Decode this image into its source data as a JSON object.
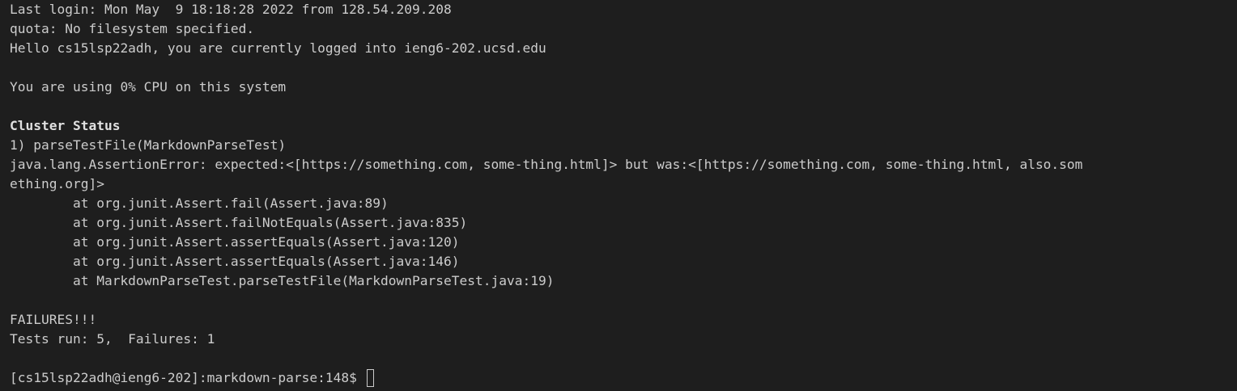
{
  "terminal": {
    "lines": [
      "Last login: Mon May  9 18:18:28 2022 from 128.54.209.208",
      "quota: No filesystem specified.",
      "Hello cs15lsp22adh, you are currently logged into ieng6-202.ucsd.edu",
      "",
      "You are using 0% CPU on this system",
      "",
      "Cluster Status",
      "1) parseTestFile(MarkdownParseTest)",
      "java.lang.AssertionError: expected:<[https://something.com, some-thing.html]> but was:<[https://something.com, some-thing.html, also.som",
      "ething.org]>",
      "        at org.junit.Assert.fail(Assert.java:89)",
      "        at org.junit.Assert.failNotEquals(Assert.java:835)",
      "        at org.junit.Assert.assertEquals(Assert.java:120)",
      "        at org.junit.Assert.assertEquals(Assert.java:146)",
      "        at MarkdownParseTest.parseTestFile(MarkdownParseTest.java:19)",
      "",
      "FAILURES!!!",
      "Tests run: 5,  Failures: 1",
      ""
    ],
    "prompt": "[cs15lsp22adh@ieng6-202]:markdown-parse:148$ ",
    "colors": {
      "background": "#1e1e1e",
      "foreground": "#cccccc"
    }
  }
}
